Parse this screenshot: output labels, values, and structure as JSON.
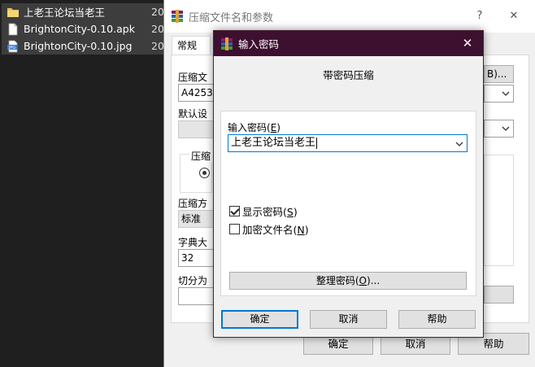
{
  "files": [
    {
      "icon": "folder-icon",
      "name": "上老王论坛当老王",
      "date": "20"
    },
    {
      "icon": "apk-file-icon",
      "name": "BrightonCity-0.10.apk",
      "date": "20"
    },
    {
      "icon": "jpg-file-icon",
      "name": "BrightonCity-0.10.jpg",
      "date": "20"
    }
  ],
  "back_window": {
    "title": "压缩文件名和参数",
    "help_glyph": "?",
    "close_glyph": "✕",
    "tab_general": "常规",
    "archive_label": "压缩文",
    "archive_value": "A4253",
    "browse_label": "B)...",
    "default_profile_label": "默认设",
    "format_group_label": "压缩",
    "method_label": "压缩方",
    "method_value": "标准",
    "dict_label": "字典大",
    "dict_value": "32",
    "split_label": "切分为",
    "ok": "确定",
    "cancel": "取消",
    "help": "帮助"
  },
  "dialog": {
    "title": "输入密码",
    "close_glyph": "✕",
    "heading": "带密码压缩",
    "password_label": "输入密码",
    "password_key": "E",
    "password_value": "上老王论坛当老王",
    "show_password_label": "显示密码",
    "show_password_key": "S",
    "show_password_checked": true,
    "encrypt_names_label": "加密文件名",
    "encrypt_names_key": "N",
    "encrypt_names_checked": false,
    "organize_label": "整理密码",
    "organize_key": "O",
    "organize_suffix": "...",
    "ok": "确定",
    "cancel": "取消",
    "help": "帮助"
  },
  "colors": {
    "dialog_titlebar": "#3d1030",
    "focus_blue": "#0078d7",
    "explorer_bg": "#1f1f1f",
    "selected_row": "#3d3d3d"
  }
}
